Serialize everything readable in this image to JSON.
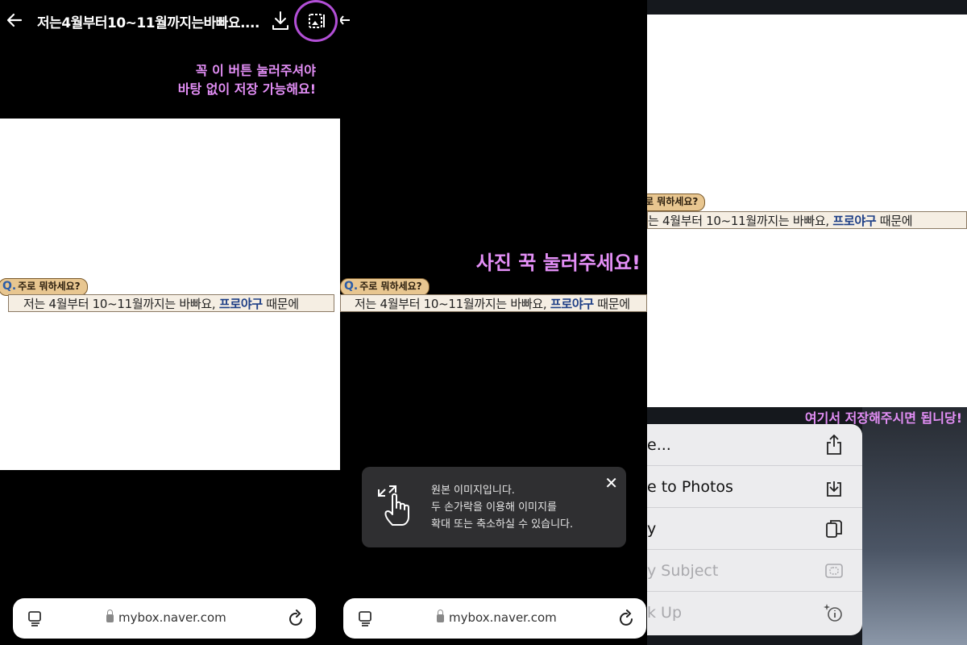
{
  "panel1": {
    "title": "저는4월부터10~11월까지는바빠요....",
    "hint": "꼭 이 버튼 눌러주셔야\n바탕 없이 저장 가능해요!",
    "question": "주로 뭐하세요?",
    "q_mark": "Q.",
    "caption_main": "저는 4월부터 10~11월까지는 바빠요, ",
    "caption_highlight": "프로야구",
    "caption_tail": " 때문에",
    "url": "mybox.naver.com"
  },
  "panel2": {
    "hint": "사진 꾹 눌러주세요!",
    "question": "주로 뭐하세요?",
    "q_mark": "Q.",
    "caption_main": "저는 4월부터 10~11월까지는 바빠요, ",
    "caption_highlight": "프로야구",
    "caption_tail": " 때문에",
    "toast_text": "원본 이미지입니다.\n두 손가락을 이용해 이미지를\n확대 또는 축소하실 수 있습니다.",
    "toast_close": "✕",
    "url": "mybox.naver.com"
  },
  "panel3": {
    "question": "로 뭐하세요?",
    "caption_main": "는 4월부터 10~11월까지는 바빠요, ",
    "caption_highlight": "프로야구",
    "caption_tail": " 때문에",
    "hint": "여기서 저장해주시면 됩니당!",
    "menu": [
      "e...",
      "e to Photos",
      "y",
      "y Subject",
      "k Up"
    ]
  },
  "colors": {
    "accent_purple": "#b24fd6",
    "hint_pink": "#e48ff7"
  }
}
